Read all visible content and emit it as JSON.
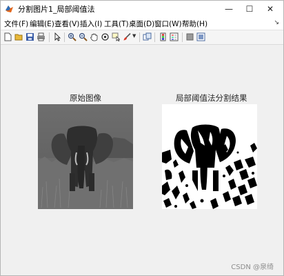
{
  "window": {
    "title": "分割图片1_局部阈值法"
  },
  "controls": {
    "minimize": "—",
    "maximize": "☐",
    "close": "✕"
  },
  "menu": {
    "items": [
      {
        "label": "文件(F)"
      },
      {
        "label": "编辑(E)"
      },
      {
        "label": "查看(V)"
      },
      {
        "label": "插入(I)"
      },
      {
        "label": "工具(T)"
      },
      {
        "label": "桌面(D)"
      },
      {
        "label": "窗口(W)"
      },
      {
        "label": "帮助(H)"
      }
    ],
    "pin": "↘"
  },
  "toolbar": {
    "icons": [
      "new-figure-icon",
      "open-file-icon",
      "save-icon",
      "print-icon",
      "pointer-icon",
      "zoom-in-icon",
      "zoom-out-icon",
      "pan-icon",
      "rotate-icon",
      "data-cursor-icon",
      "brush-icon",
      "link-plot-icon",
      "colorbar-icon",
      "legend-icon",
      "hide-plot-tools-icon",
      "show-plot-tools-icon"
    ]
  },
  "figure": {
    "left_title": "原始图像",
    "right_title": "局部阈值法分割结果"
  },
  "watermark": "CSDN @泉绮"
}
